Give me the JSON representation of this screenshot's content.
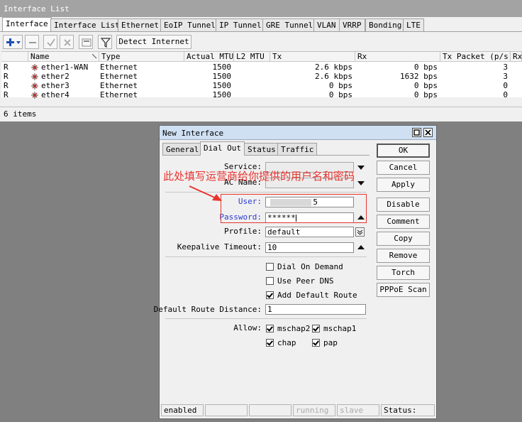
{
  "interface_list": {
    "title": "Interface List",
    "tabs": [
      "Interface",
      "Interface List",
      "Ethernet",
      "EoIP Tunnel",
      "IP Tunnel",
      "GRE Tunnel",
      "VLAN",
      "VRRP",
      "Bonding",
      "LTE"
    ],
    "toolbar": {
      "add_icon": "plus-icon",
      "remove_icon": "minus-icon",
      "enable_icon": "check-icon",
      "disable_icon": "x-icon",
      "comment_icon": "note-icon",
      "filter_icon": "filter-icon",
      "detect_label": "Detect Internet"
    },
    "columns": [
      "Name",
      "Type",
      "Actual MTU",
      "L2 MTU",
      "Tx",
      "Rx",
      "Tx Packet (p/s)",
      "Rx"
    ],
    "rows": [
      {
        "flag": "R",
        "name": "ether1-WAN",
        "type": "Ethernet",
        "mtu": "1500",
        "l2mtu": "",
        "tx": "2.6 kbps",
        "rx": "0 bps",
        "txp": "3"
      },
      {
        "flag": "R",
        "name": "ether2",
        "type": "Ethernet",
        "mtu": "1500",
        "l2mtu": "",
        "tx": "2.6 kbps",
        "rx": "1632 bps",
        "txp": "3"
      },
      {
        "flag": "R",
        "name": "ether3",
        "type": "Ethernet",
        "mtu": "1500",
        "l2mtu": "",
        "tx": "0 bps",
        "rx": "0 bps",
        "txp": "0"
      },
      {
        "flag": "R",
        "name": "ether4",
        "type": "Ethernet",
        "mtu": "1500",
        "l2mtu": "",
        "tx": "0 bps",
        "rx": "0 bps",
        "txp": "0"
      }
    ],
    "status": "6 items"
  },
  "dialog": {
    "title": "New Interface",
    "tabs": [
      "General",
      "Dial Out",
      "Status",
      "Traffic"
    ],
    "fields": {
      "service_label": "Service:",
      "service_value": "",
      "ac_name_label": "AC Name:",
      "ac_name_value": "",
      "user_label": "User:",
      "user_value": "5",
      "password_label": "Password:",
      "password_value": "******",
      "profile_label": "Profile:",
      "profile_value": "default",
      "keepalive_label": "Keepalive Timeout:",
      "keepalive_value": "10",
      "dial_on_demand_label": "Dial On Demand",
      "dial_on_demand_checked": false,
      "use_peer_dns_label": "Use Peer DNS",
      "use_peer_dns_checked": false,
      "add_default_route_label": "Add Default Route",
      "add_default_route_checked": true,
      "default_route_distance_label": "Default Route Distance:",
      "default_route_distance_value": "1",
      "allow_label": "Allow:",
      "allow": [
        {
          "label": "mschap2",
          "checked": true
        },
        {
          "label": "mschap1",
          "checked": true
        },
        {
          "label": "chap",
          "checked": true
        },
        {
          "label": "pap",
          "checked": true
        }
      ]
    },
    "buttons": [
      "OK",
      "Cancel",
      "Apply",
      "Disable",
      "Comment",
      "Copy",
      "Remove",
      "Torch",
      "PPPoE Scan"
    ],
    "statusbar": [
      "enabled",
      "",
      "",
      "running",
      "slave",
      "Status:"
    ]
  },
  "annotation": {
    "text": "此处填写运营商给你提供的用户名和密码",
    "color": "#e8342f"
  }
}
